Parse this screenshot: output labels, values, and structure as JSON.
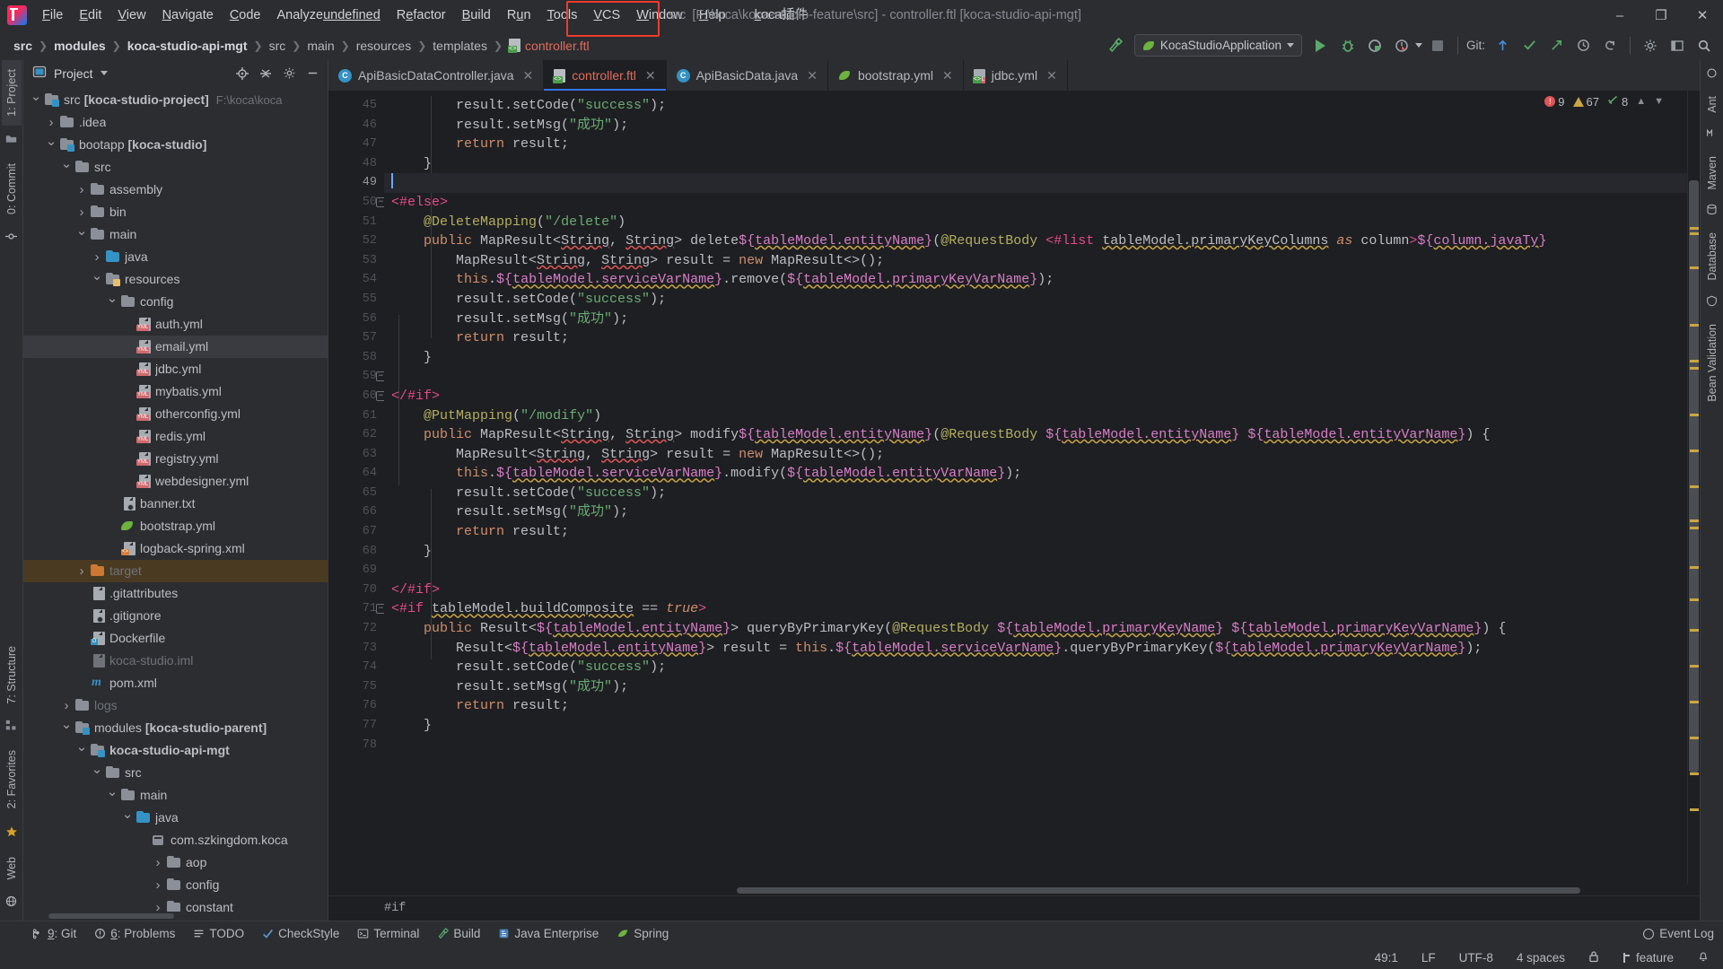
{
  "window": {
    "title_prefix": "src",
    "title": "[F:\\koca\\koca-studio-feature\\src] - controller.ftl [koca-studio-api-mgt]",
    "minimize": "–",
    "maximize": "❐",
    "close": "✕"
  },
  "menubar": {
    "logo": "intellij-idea-logo",
    "items": [
      {
        "label": "File"
      },
      {
        "label": "Edit"
      },
      {
        "label": "View"
      },
      {
        "label": "Navigate"
      },
      {
        "label": "Code"
      },
      {
        "label": "Analyze"
      },
      {
        "label": "Refactor"
      },
      {
        "label": "Build"
      },
      {
        "label": "Run"
      },
      {
        "label": "Tools"
      },
      {
        "label": "VCS"
      },
      {
        "label": "Window"
      },
      {
        "label": "Help"
      },
      {
        "label": "koca插件",
        "highlighted": true
      }
    ]
  },
  "navbar": {
    "breadcrumbs": [
      {
        "label": "src",
        "bold": true
      },
      {
        "label": "modules",
        "bold": true
      },
      {
        "label": "koca-studio-api-mgt",
        "bold": true
      },
      {
        "label": "src",
        "bold": false
      },
      {
        "label": "main",
        "bold": false
      },
      {
        "label": "resources",
        "bold": false
      },
      {
        "label": "templates",
        "bold": false
      },
      {
        "label": "controller.ftl",
        "bold": false,
        "file": true
      }
    ],
    "run_config": "KocaStudioApplication",
    "git_label": "Git:",
    "icons": {
      "build": "hammer-icon",
      "run": "run-icon",
      "debug": "debug-icon",
      "run_coverage": "run-with-coverage-icon",
      "profiler": "profiler-icon",
      "stop": "stop-icon",
      "git_update": "git-update-icon",
      "git_commit": "git-commit-check-icon",
      "git_push": "git-push-icon",
      "git_history": "git-history-icon",
      "undo": "undo-icon",
      "settings": "settings-icon",
      "layout": "layout-icon",
      "search": "search-icon"
    }
  },
  "left_rail": {
    "top": [
      {
        "label": "1: Project",
        "name": "sidebar-tab-project",
        "active": true,
        "icon": "project-icon"
      },
      {
        "label": "0: Commit",
        "name": "sidebar-tab-commit",
        "active": false,
        "icon": "commit-icon"
      }
    ],
    "bottom": [
      {
        "label": "7: Structure",
        "name": "sidebar-tab-structure",
        "icon": "structure-icon"
      },
      {
        "label": "2: Favorites",
        "name": "sidebar-tab-favorites",
        "icon": "star-icon"
      },
      {
        "label": "Web",
        "name": "sidebar-tab-web",
        "icon": "web-icon"
      }
    ]
  },
  "right_rail": {
    "items": [
      {
        "label": "Ant",
        "name": "tool-tab-ant"
      },
      {
        "label": "Maven",
        "name": "tool-tab-maven"
      },
      {
        "label": "Database",
        "name": "tool-tab-database"
      },
      {
        "label": "Bean Validation",
        "name": "tool-tab-bean-validation"
      }
    ]
  },
  "project_panel": {
    "title": "Project",
    "actions": [
      "locate-icon",
      "collapse-all-icon",
      "settings-icon",
      "hide-icon"
    ],
    "tree": [
      {
        "depth": 0,
        "arrow": "down",
        "icon": "module-folder",
        "label": "src [koca-studio-project]",
        "bold_part": "[koca-studio-project]",
        "path": "F:\\koca\\koca",
        "state": "normal"
      },
      {
        "depth": 1,
        "arrow": "right",
        "icon": "folder",
        "label": ".idea",
        "state": "normal"
      },
      {
        "depth": 1,
        "arrow": "down",
        "icon": "module-folder",
        "label": "bootapp [koca-studio]",
        "state": "normal"
      },
      {
        "depth": 2,
        "arrow": "down",
        "icon": "folder",
        "label": "src",
        "state": "normal"
      },
      {
        "depth": 3,
        "arrow": "right",
        "icon": "folder",
        "label": "assembly",
        "state": "normal"
      },
      {
        "depth": 3,
        "arrow": "right",
        "icon": "folder",
        "label": "bin",
        "state": "normal"
      },
      {
        "depth": 3,
        "arrow": "down",
        "icon": "folder",
        "label": "main",
        "state": "normal"
      },
      {
        "depth": 4,
        "arrow": "right",
        "icon": "source-folder",
        "label": "java",
        "state": "normal"
      },
      {
        "depth": 4,
        "arrow": "down",
        "icon": "resource-folder",
        "label": "resources",
        "state": "normal"
      },
      {
        "depth": 5,
        "arrow": "down",
        "icon": "folder",
        "label": "config",
        "state": "normal"
      },
      {
        "depth": 6,
        "arrow": "none",
        "icon": "yml-file",
        "label": "auth.yml",
        "state": "normal"
      },
      {
        "depth": 6,
        "arrow": "none",
        "icon": "yml-file",
        "label": "email.yml",
        "state": "selected"
      },
      {
        "depth": 6,
        "arrow": "none",
        "icon": "yml-file",
        "label": "jdbc.yml",
        "state": "normal"
      },
      {
        "depth": 6,
        "arrow": "none",
        "icon": "yml-file",
        "label": "mybatis.yml",
        "state": "normal"
      },
      {
        "depth": 6,
        "arrow": "none",
        "icon": "yml-file",
        "label": "otherconfig.yml",
        "state": "normal"
      },
      {
        "depth": 6,
        "arrow": "none",
        "icon": "yml-file",
        "label": "redis.yml",
        "state": "normal"
      },
      {
        "depth": 6,
        "arrow": "none",
        "icon": "yml-file",
        "label": "registry.yml",
        "state": "normal"
      },
      {
        "depth": 6,
        "arrow": "none",
        "icon": "yml-file",
        "label": "webdesigner.yml",
        "state": "normal"
      },
      {
        "depth": 5,
        "arrow": "none",
        "icon": "txt-file",
        "label": "banner.txt",
        "state": "normal"
      },
      {
        "depth": 5,
        "arrow": "none",
        "icon": "spring-file",
        "label": "bootstrap.yml",
        "state": "normal"
      },
      {
        "depth": 5,
        "arrow": "none",
        "icon": "xml-file",
        "label": "logback-spring.xml",
        "state": "normal"
      },
      {
        "depth": 3,
        "arrow": "right",
        "icon": "target-folder",
        "label": "target",
        "state": "target"
      },
      {
        "depth": 3,
        "arrow": "none",
        "icon": "text-file",
        "label": ".gitattributes",
        "state": "normal"
      },
      {
        "depth": 3,
        "arrow": "none",
        "icon": "ignore-file",
        "label": ".gitignore",
        "state": "normal"
      },
      {
        "depth": 3,
        "arrow": "none",
        "icon": "docker-file",
        "label": "Dockerfile",
        "state": "normal"
      },
      {
        "depth": 3,
        "arrow": "none",
        "icon": "iml-file",
        "label": "koca-studio.iml",
        "state": "dim"
      },
      {
        "depth": 3,
        "arrow": "none",
        "icon": "maven-file",
        "label": "pom.xml",
        "state": "normal"
      },
      {
        "depth": 2,
        "arrow": "right",
        "icon": "folder",
        "label": "logs",
        "state": "dim"
      },
      {
        "depth": 2,
        "arrow": "down",
        "icon": "module-folder",
        "label": "modules [koca-studio-parent]",
        "state": "normal"
      },
      {
        "depth": 3,
        "arrow": "down",
        "icon": "module-folder",
        "label": "koca-studio-api-mgt",
        "state": "normal"
      },
      {
        "depth": 4,
        "arrow": "down",
        "icon": "folder",
        "label": "src",
        "state": "normal"
      },
      {
        "depth": 5,
        "arrow": "down",
        "icon": "folder",
        "label": "main",
        "state": "normal"
      },
      {
        "depth": 6,
        "arrow": "down",
        "icon": "source-folder",
        "label": "java",
        "state": "normal"
      },
      {
        "depth": 7,
        "arrow": "none",
        "icon": "package",
        "label": "com.szkingdom.koca",
        "state": "normal"
      },
      {
        "depth": 8,
        "arrow": "right",
        "icon": "folder",
        "label": "aop",
        "state": "normal"
      },
      {
        "depth": 8,
        "arrow": "right",
        "icon": "folder",
        "label": "config",
        "state": "normal"
      },
      {
        "depth": 8,
        "arrow": "right",
        "icon": "folder",
        "label": "constant",
        "state": "normal"
      }
    ]
  },
  "editor": {
    "tabs": [
      {
        "label": "ApiBasicDataController.java",
        "icon": "java-class-icon",
        "active": false
      },
      {
        "label": "controller.ftl",
        "icon": "ftl-file-icon",
        "active": true
      },
      {
        "label": "ApiBasicData.java",
        "icon": "java-class-icon",
        "active": false
      },
      {
        "label": "bootstrap.yml",
        "icon": "spring-file-icon",
        "active": false
      },
      {
        "label": "jdbc.yml",
        "icon": "yml-file-icon",
        "active": false
      }
    ],
    "inspection": {
      "errors": "9",
      "warnings": "67",
      "weak": "8"
    },
    "first_line_number": 45,
    "current_line": 49,
    "breadcrumb": "#if",
    "lines": [
      {
        "n": 45,
        "text": "        result.setCode(\"success\");"
      },
      {
        "n": 46,
        "text": "        result.setMsg(\"成功\");"
      },
      {
        "n": 47,
        "text": "        return result;"
      },
      {
        "n": 48,
        "text": "    }"
      },
      {
        "n": 49,
        "text": ""
      },
      {
        "n": 50,
        "text": "<#else>"
      },
      {
        "n": 51,
        "text": "    @DeleteMapping(\"/delete\")"
      },
      {
        "n": 52,
        "text": "    public MapResult<String, String> delete${tableModel.entityName}(@RequestBody <#list tableModel.primaryKeyColumns as column>${column.javaTyp"
      },
      {
        "n": 53,
        "text": "        MapResult<String, String> result = new MapResult<>();"
      },
      {
        "n": 54,
        "text": "        this.${tableModel.serviceVarName}.remove(${tableModel.primaryKeyVarName});"
      },
      {
        "n": 55,
        "text": "        result.setCode(\"success\");"
      },
      {
        "n": 56,
        "text": "        result.setMsg(\"成功\");"
      },
      {
        "n": 57,
        "text": "        return result;"
      },
      {
        "n": 58,
        "text": "    }"
      },
      {
        "n": 59,
        "text": ""
      },
      {
        "n": 60,
        "text": "</#if>"
      },
      {
        "n": 61,
        "text": "    @PutMapping(\"/modify\")"
      },
      {
        "n": 62,
        "text": "    public MapResult<String, String> modify${tableModel.entityName}(@RequestBody ${tableModel.entityName} ${tableModel.entityVarName}) {"
      },
      {
        "n": 63,
        "text": "        MapResult<String, String> result = new MapResult<>();"
      },
      {
        "n": 64,
        "text": "        this.${tableModel.serviceVarName}.modify(${tableModel.entityVarName});"
      },
      {
        "n": 65,
        "text": "        result.setCode(\"success\");"
      },
      {
        "n": 66,
        "text": "        result.setMsg(\"成功\");"
      },
      {
        "n": 67,
        "text": "        return result;"
      },
      {
        "n": 68,
        "text": "    }"
      },
      {
        "n": 69,
        "text": ""
      },
      {
        "n": 70,
        "text": "</#if>"
      },
      {
        "n": 71,
        "text": "<#if tableModel.buildComposite == true>"
      },
      {
        "n": 72,
        "text": "    public Result<${tableModel.entityName}> queryByPrimaryKey(@RequestBody ${tableModel.primaryKeyName} ${tableModel.primaryKeyVarName}) {"
      },
      {
        "n": 73,
        "text": "        Result<${tableModel.entityName}> result = this.${tableModel.serviceVarName}.queryByPrimaryKey(${tableModel.primaryKeyVarName});"
      },
      {
        "n": 74,
        "text": "        result.setCode(\"success\");"
      },
      {
        "n": 75,
        "text": "        result.setMsg(\"成功\");"
      },
      {
        "n": 76,
        "text": "        return result;"
      },
      {
        "n": 77,
        "text": "    }"
      },
      {
        "n": 78,
        "text": ""
      }
    ]
  },
  "bottom_bar": {
    "items": [
      {
        "label": "9: Git",
        "icon": "git-icon"
      },
      {
        "label": "6: Problems",
        "icon": "problems-icon"
      },
      {
        "label": "TODO",
        "icon": "todo-icon"
      },
      {
        "label": "CheckStyle",
        "icon": "checkstyle-icon"
      },
      {
        "label": "Terminal",
        "icon": "terminal-icon"
      },
      {
        "label": "Build",
        "icon": "build-icon"
      },
      {
        "label": "Java Enterprise",
        "icon": "java-enterprise-icon"
      },
      {
        "label": "Spring",
        "icon": "spring-icon"
      }
    ],
    "event_log": "Event Log"
  },
  "statusbar": {
    "caret": "49:1",
    "line_separator": "LF",
    "encoding": "UTF-8",
    "indent": "4 spaces",
    "branch": "feature",
    "lock_icon": "lock-icon"
  }
}
